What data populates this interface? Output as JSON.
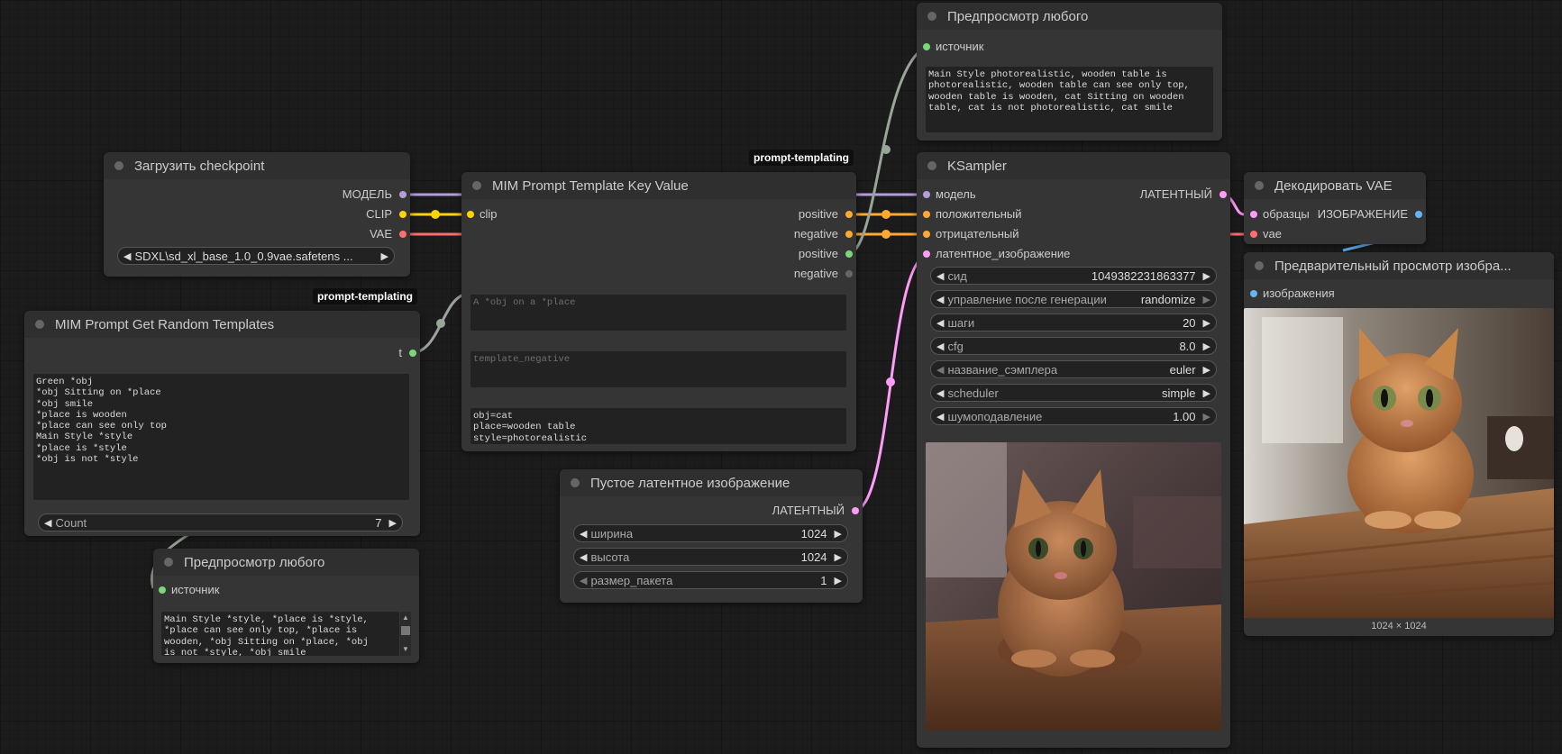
{
  "colors": {
    "model": "#b39ddb",
    "clip": "#ffd500",
    "vae": "#ff6e6e",
    "conditioning": "#ffa931",
    "string": "#7cd67c",
    "latent": "#ff9cf9",
    "image": "#64b5f6",
    "anywire": "#9aa59a"
  },
  "badges": {
    "prompt_templating_1": "prompt-templating",
    "prompt_templating_2": "prompt-templating"
  },
  "load_checkpoint": {
    "title": "Загрузить checkpoint",
    "out_model": "МОДЕЛЬ",
    "out_clip": "CLIP",
    "out_vae": "VAE",
    "ckpt_name": "SDXL\\sd_xl_base_1.0_0.9vae.safetens ..."
  },
  "get_random_templates": {
    "title": "MIM Prompt Get Random Templates",
    "out_t": "t",
    "text": "Green *obj\n*obj Sitting on *place\n*obj smile\n*place is wooden\n*place can see only top\nMain Style *style\n*place is *style\n*obj is not *style",
    "count_label": "Count",
    "count_value": "7"
  },
  "preview_any_bottom": {
    "title": "Предпросмотр любого",
    "in_source": "источник",
    "text": "Main Style *style, *place is *style,\n*place can see only top, *place is\nwooden, *obj Sitting on *place, *obj\nis not *style, *obj smile"
  },
  "template_key_value": {
    "title": "MIM Prompt Template Key Value",
    "in_clip": "clip",
    "out_positive": "positive",
    "out_negative": "negative",
    "out_positive_text": "positive",
    "out_negative_text": "negative",
    "template_positive": "A *obj on a *place",
    "template_negative_placeholder": "template_negative",
    "key_values": "obj=cat\nplace=wooden table\nstyle=photorealistic"
  },
  "empty_latent": {
    "title": "Пустое латентное изображение",
    "out_latent": "ЛАТЕНТНЫЙ",
    "width_label": "ширина",
    "width_value": "1024",
    "height_label": "высота",
    "height_value": "1024",
    "batch_label": "размер_пакета",
    "batch_value": "1"
  },
  "preview_any_top": {
    "title": "Предпросмотр любого",
    "in_source": "источник",
    "text": "Main Style photorealistic, wooden table is\nphotorealistic, wooden table can see only top,\nwooden table is wooden, cat Sitting on wooden\ntable, cat is not photorealistic, cat smile"
  },
  "ksampler": {
    "title": "KSampler",
    "in_model": "модель",
    "in_positive": "положительный",
    "in_negative": "отрицательный",
    "in_latent": "латентное_изображение",
    "out_latent": "ЛАТЕНТНЫЙ",
    "seed_label": "сид",
    "seed_value": "1049382231863377",
    "control_label": "управление после генерации",
    "control_value": "randomize",
    "steps_label": "шаги",
    "steps_value": "20",
    "cfg_label": "cfg",
    "cfg_value": "8.0",
    "sampler_label": "название_сэмплера",
    "sampler_value": "euler",
    "scheduler_label": "scheduler",
    "scheduler_value": "simple",
    "denoise_label": "шумоподавление",
    "denoise_value": "1.00"
  },
  "vae_decode": {
    "title": "Декодировать VAE",
    "in_samples": "образцы",
    "in_vae": "vae",
    "out_image": "ИЗОБРАЖЕНИЕ"
  },
  "preview_image": {
    "title": "Предварительный просмотр изобра...",
    "in_images": "изображения",
    "dimensions": "1024 × 1024"
  }
}
